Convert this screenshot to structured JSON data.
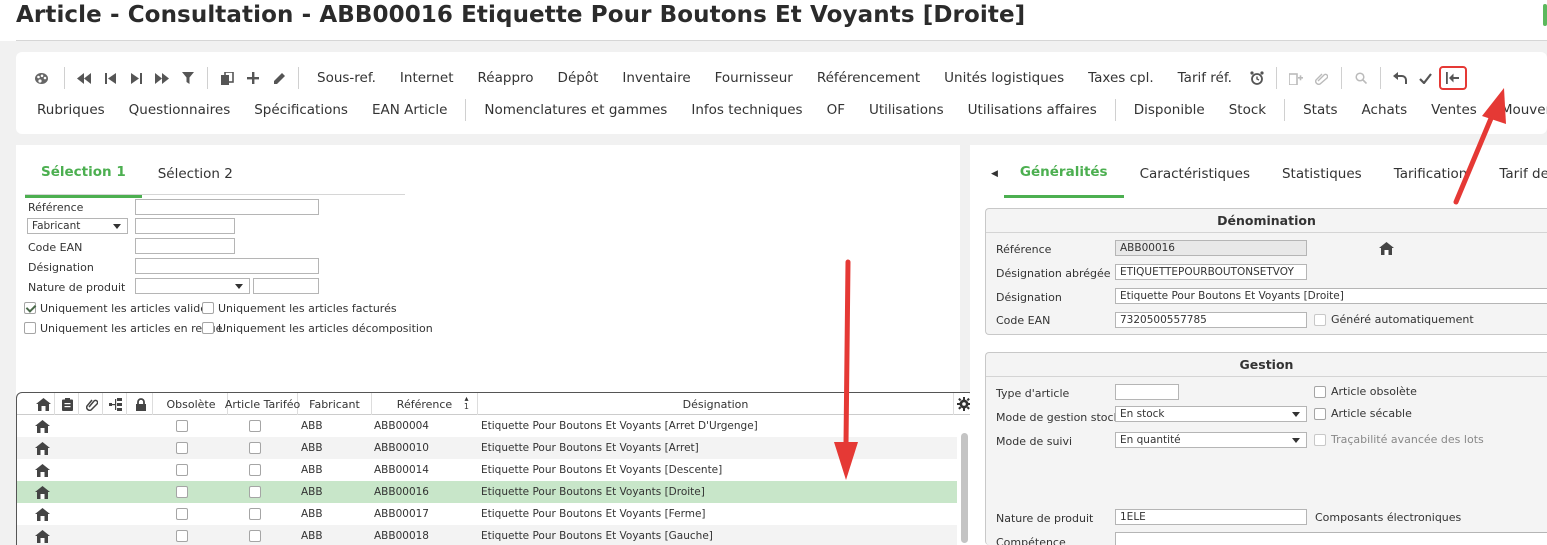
{
  "page_title": "Article - Consultation - ABB00016 Etiquette Pour Boutons Et Voyants [Droite]",
  "colors": {
    "accent_green": "#4caf50",
    "selected_row": "#c8e6c9",
    "highlight_red": "#e53935"
  },
  "toolbar": {
    "row1_links": [
      "Sous-ref.",
      "Internet",
      "Réappro",
      "Dépôt",
      "Inventaire",
      "Fournisseur",
      "Référencement",
      "Unités logistiques",
      "Taxes cpl.",
      "Tarif réf."
    ],
    "row2_group1": [
      "Rubriques",
      "Questionnaires",
      "Spécifications",
      "EAN Article"
    ],
    "row2_group2": [
      "Nomenclatures et gammes",
      "Infos techniques",
      "OF",
      "Utilisations",
      "Utilisations affaires"
    ],
    "row2_group3": [
      "Disponible",
      "Stock"
    ],
    "row2_group4": [
      "Stats",
      "Achats",
      "Ventes",
      "Mouvements"
    ]
  },
  "left": {
    "tabs": [
      "Sélection 1",
      "Sélection 2"
    ],
    "fields": {
      "reference_label": "Référence",
      "fabricant_select": "Fabricant",
      "code_ean_label": "Code EAN",
      "designation_label": "Désignation",
      "nature_label": "Nature de produit"
    },
    "checkboxes": [
      {
        "label": "Uniquement les articles valides",
        "checked": true
      },
      {
        "label": "Uniquement les articles facturés",
        "checked": false
      },
      {
        "label": "Uniquement les articles en revue",
        "checked": false
      },
      {
        "label": "Uniquement les articles décomposition",
        "checked": false
      }
    ]
  },
  "grid": {
    "columns": [
      "Obsolète",
      "Article Tariféo",
      "Fabricant",
      "Référence",
      "Désignation"
    ],
    "sort_indicator": "1",
    "rows": [
      {
        "fabricant": "ABB",
        "reference": "ABB00004",
        "designation": "Etiquette Pour Boutons Et Voyants [Arret D'Urgenge]",
        "selected": false
      },
      {
        "fabricant": "ABB",
        "reference": "ABB00010",
        "designation": "Etiquette Pour Boutons Et Voyants [Arret]",
        "selected": false
      },
      {
        "fabricant": "ABB",
        "reference": "ABB00014",
        "designation": "Etiquette Pour Boutons Et Voyants [Descente]",
        "selected": false
      },
      {
        "fabricant": "ABB",
        "reference": "ABB00016",
        "designation": "Etiquette Pour Boutons Et Voyants [Droite]",
        "selected": true
      },
      {
        "fabricant": "ABB",
        "reference": "ABB00017",
        "designation": "Etiquette Pour Boutons Et Voyants [Ferme]",
        "selected": false
      },
      {
        "fabricant": "ABB",
        "reference": "ABB00018",
        "designation": "Etiquette Pour Boutons Et Voyants [Gauche]",
        "selected": false
      }
    ]
  },
  "right": {
    "tabs": [
      "Généralités",
      "Caractéristiques",
      "Statistiques",
      "Tarification",
      "Tarif de réfé"
    ],
    "denomination": {
      "title": "Dénomination",
      "reference_label": "Référence",
      "reference_value": "ABB00016",
      "designation_abregee_label": "Désignation abrégée",
      "designation_abregee_value": "ETIQUETTEPOURBOUTONSETVOY",
      "designation_label": "Désignation",
      "designation_value": "Etiquette Pour Boutons Et Voyants [Droite]",
      "code_ean_label": "Code EAN",
      "code_ean_value": "7320500557785",
      "genere_auto_label": "Généré automatiquement"
    },
    "gestion": {
      "title": "Gestion",
      "type_article_label": "Type d'article",
      "type_article_value": "",
      "mode_gestion_label": "Mode de gestion stock",
      "mode_gestion_value": "En stock",
      "mode_suivi_label": "Mode de suivi",
      "mode_suivi_value": "En quantité",
      "article_obsolete_label": "Article obsolète",
      "article_secable_label": "Article sécable",
      "tracabilite_label": "Traçabilité avancée des lots",
      "nature_label": "Nature de produit",
      "nature_value": "1ELE",
      "nature_desc": "Composants électroniques",
      "competence_label": "Compétence"
    }
  }
}
